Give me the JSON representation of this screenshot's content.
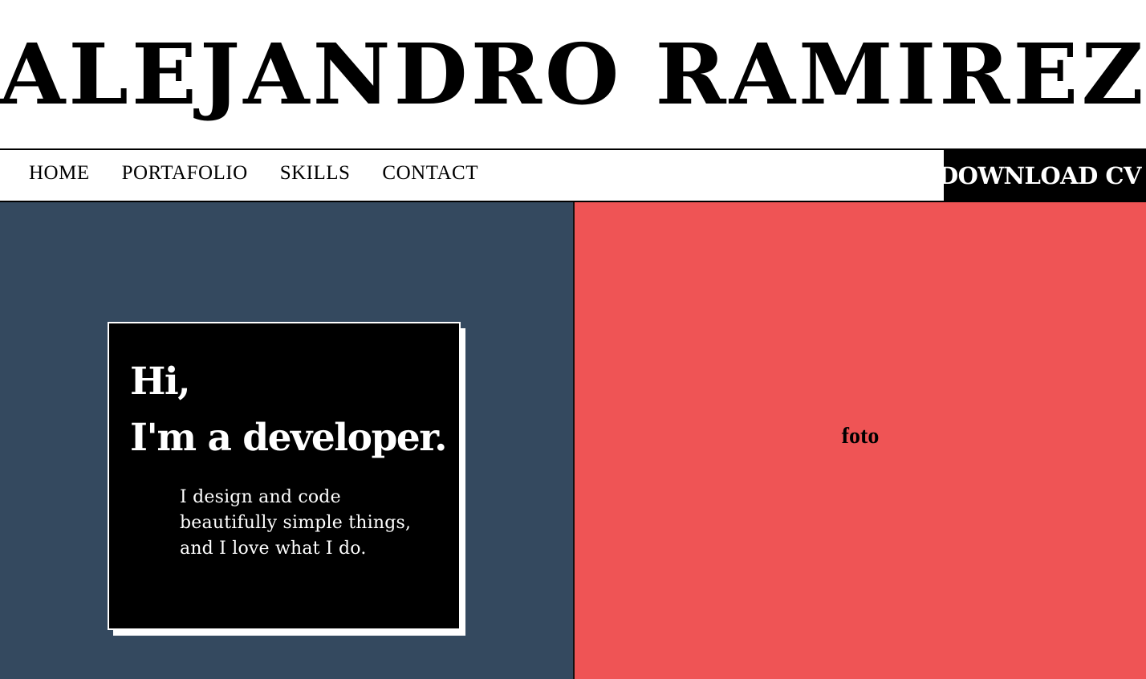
{
  "header": {
    "title": "ALEJANDRO RAMIREZ"
  },
  "nav": {
    "links": [
      "HOME",
      "PORTAFOLIO",
      "SKILLS",
      "CONTACT"
    ],
    "download_label": "DOWNLOAD CV"
  },
  "intro": {
    "greeting_line1": "Hi,",
    "greeting_line2": "I'm a developer.",
    "tagline": "I design and code beautifully simple things, and I love what I do."
  },
  "photo": {
    "label": "foto"
  },
  "colors": {
    "left_panel": "#34495f",
    "right_panel": "#ef5455",
    "card": "#000000",
    "accent": "#ffffff"
  }
}
